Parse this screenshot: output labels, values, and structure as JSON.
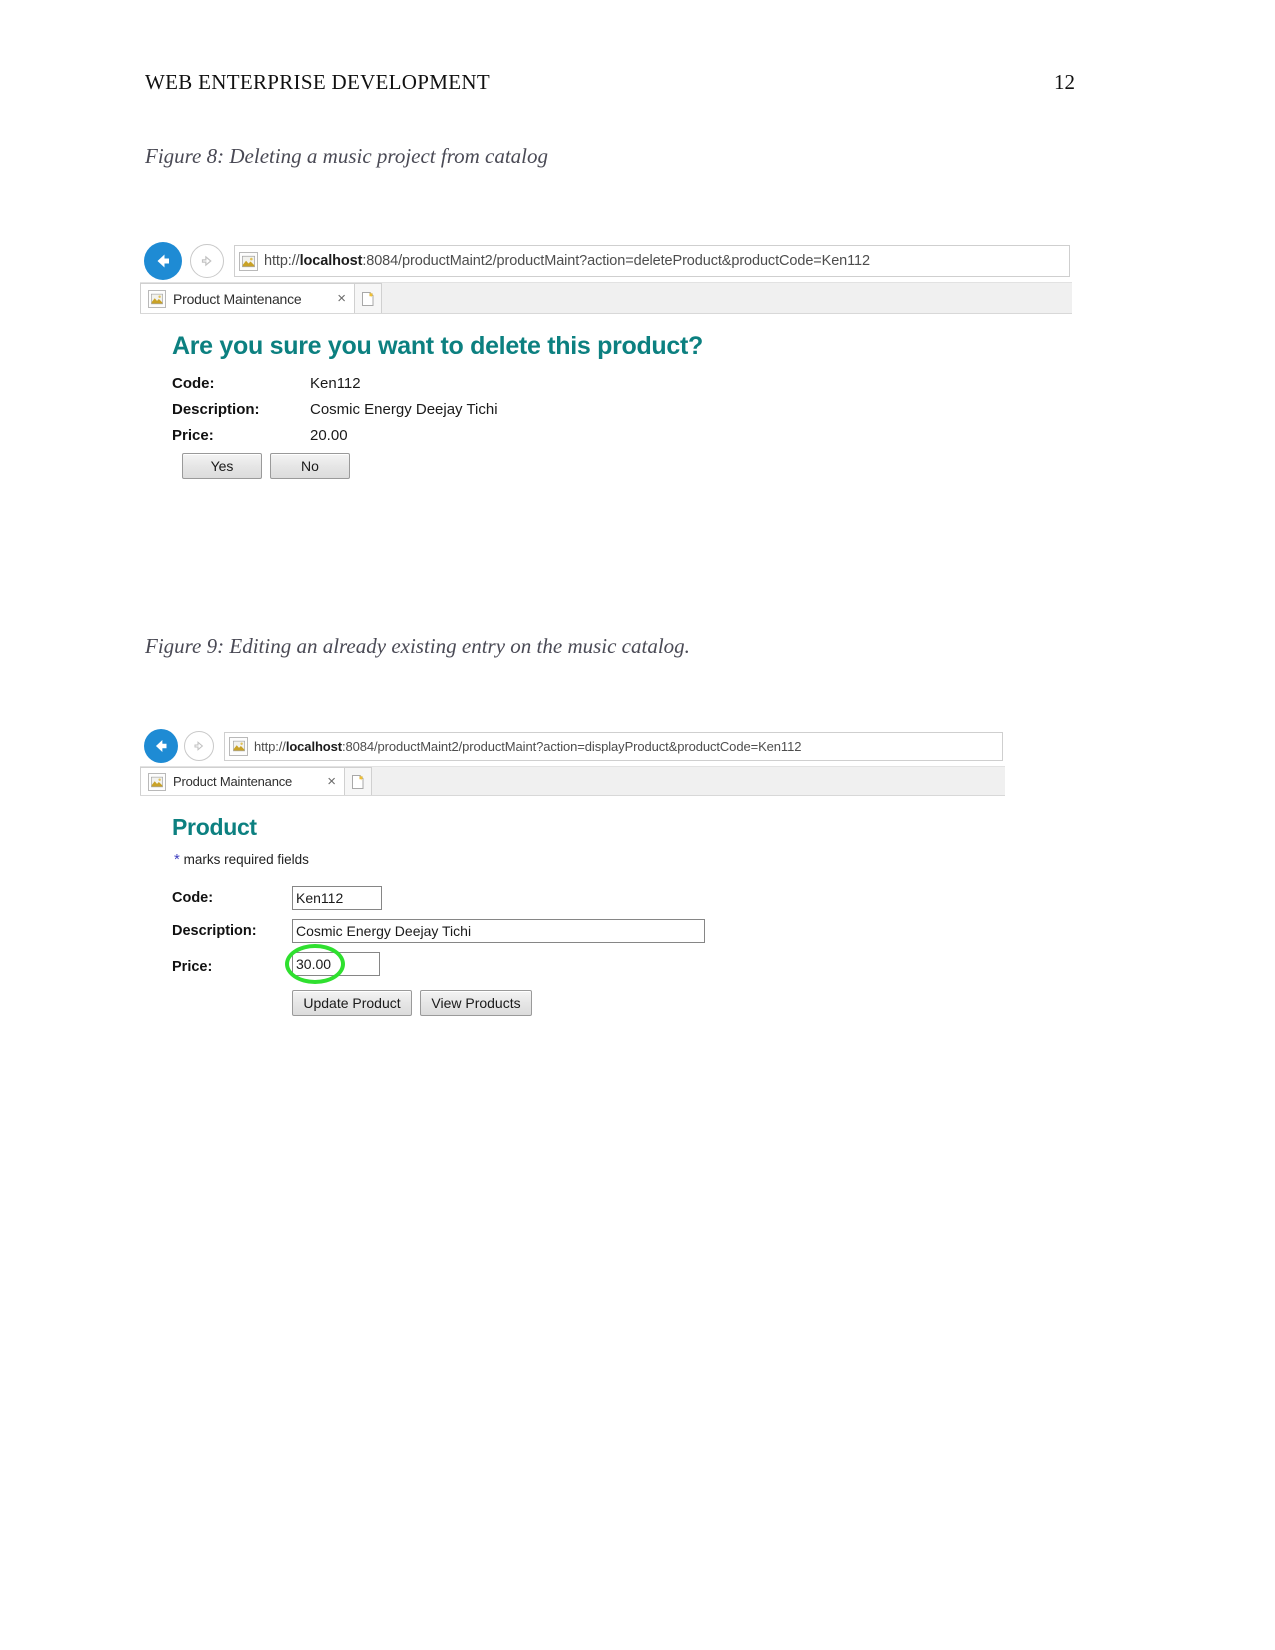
{
  "document": {
    "running_head": "WEB ENTERPRISE DEVELOPMENT",
    "page_number": "12"
  },
  "figures": [
    {
      "caption": "Figure 8: Deleting a music project from catalog",
      "browser": {
        "back_icon": "back-arrow-icon",
        "forward_icon": "forward-arrow-icon",
        "site_icon": "page-favicon-icon",
        "url_prefix": "http://",
        "url_host_bold": "localhost",
        "url_rest": ":8084/productMaint2/productMaint?action=deleteProduct&productCode=Ken112",
        "tab_title": "Product Maintenance",
        "tab_close_glyph": "×",
        "new_tab_icon": "new-tab-icon"
      },
      "page": {
        "heading": "Are you sure you want to delete this product?",
        "fields": [
          {
            "label": "Code:",
            "value": "Ken112"
          },
          {
            "label": "Description:",
            "value": "Cosmic Energy Deejay Tichi"
          },
          {
            "label": "Price:",
            "value": "20.00"
          }
        ],
        "buttons": [
          {
            "label": "Yes"
          },
          {
            "label": "No"
          }
        ]
      }
    },
    {
      "caption": "Figure 9: Editing an already existing entry on the music catalog.",
      "browser": {
        "back_icon": "back-arrow-icon",
        "forward_icon": "forward-arrow-icon",
        "site_icon": "page-favicon-icon",
        "url_prefix": "http://",
        "url_host_bold": "localhost",
        "url_rest": ":8084/productMaint2/productMaint?action=displayProduct&productCode=Ken112",
        "tab_title": "Product Maintenance",
        "tab_close_glyph": "×",
        "new_tab_icon": "new-tab-icon"
      },
      "page": {
        "heading": "Product",
        "required_star": "*",
        "required_note": " marks required fields",
        "fields": [
          {
            "label": "Code:",
            "value": "Ken112"
          },
          {
            "label": "Description:",
            "value": "Cosmic Energy Deejay Tichi"
          },
          {
            "label": "Price:",
            "value": "30.00"
          }
        ],
        "buttons": [
          {
            "label": "Update Product"
          },
          {
            "label": "View Products"
          }
        ],
        "annotation": {
          "type": "highlight-circle",
          "color": "#2fe02f",
          "target": "price-input"
        }
      }
    }
  ],
  "colors": {
    "heading_teal": "#0c8080",
    "back_button_blue": "#1e8bd4",
    "highlight_green": "#2fe02f",
    "required_star_blue": "#3f3fbf",
    "caption_gray": "#4a4a55"
  }
}
